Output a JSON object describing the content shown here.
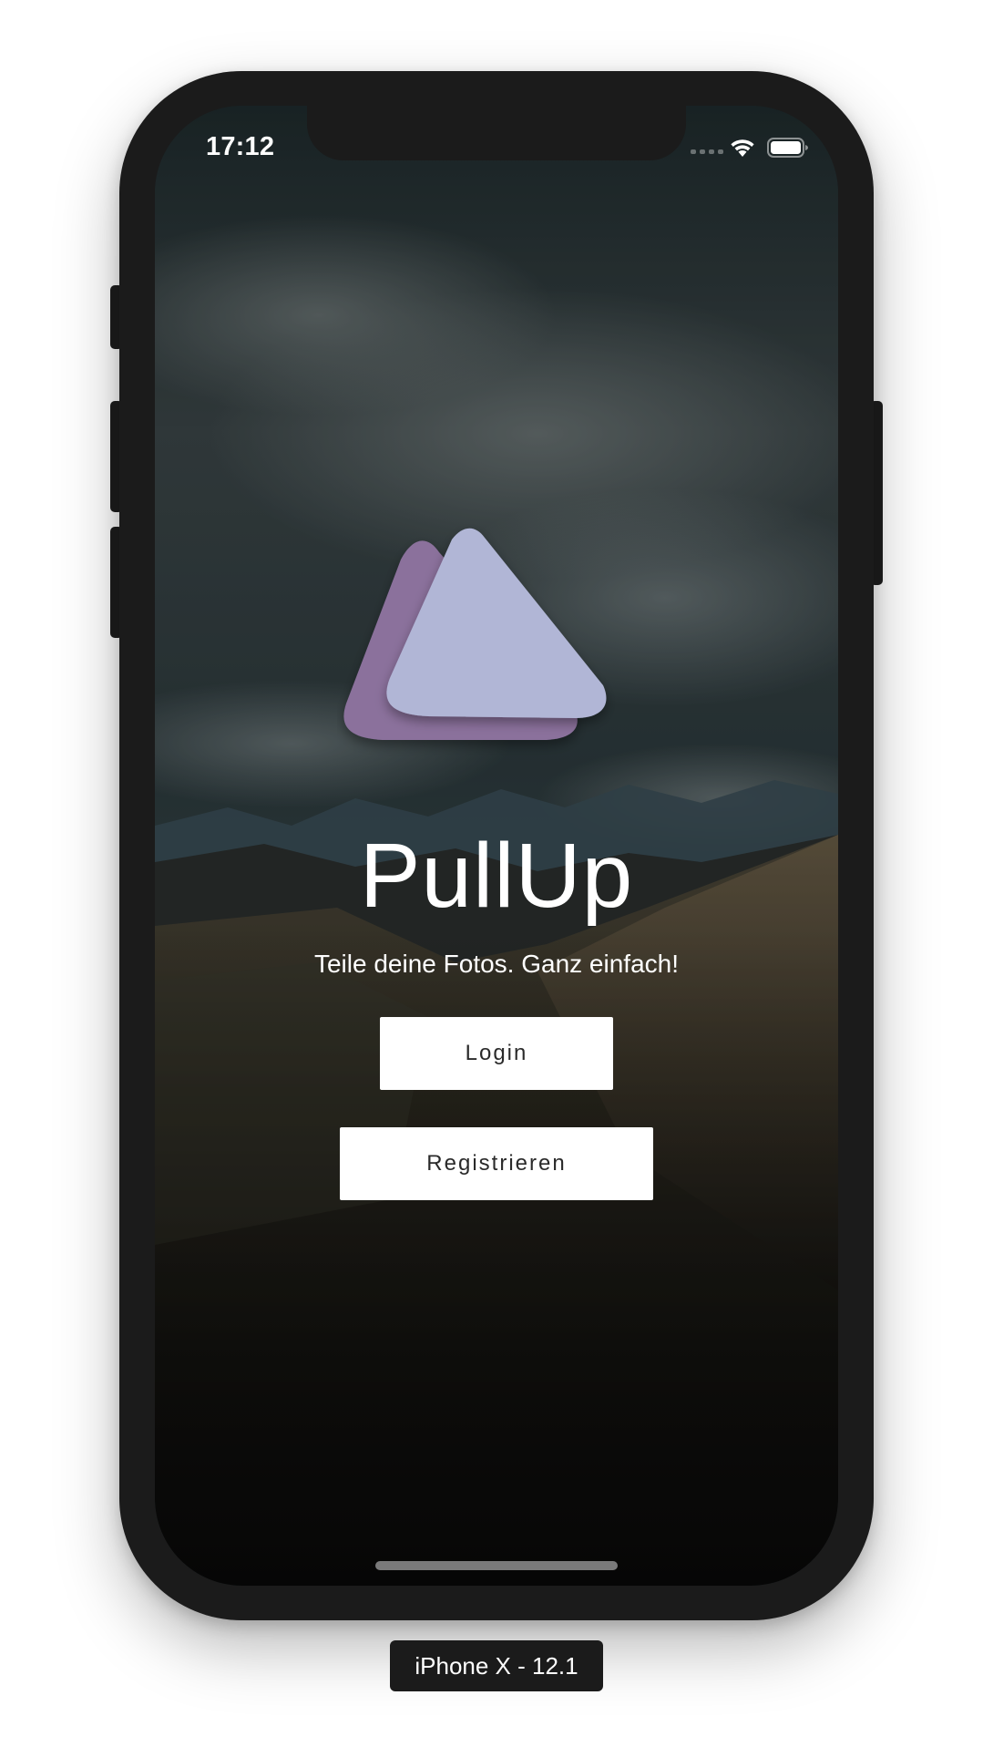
{
  "status_bar": {
    "time": "17:12",
    "icons": [
      "cellular-signal-icon",
      "wifi-icon",
      "battery-icon"
    ]
  },
  "app": {
    "logo": "pullup-logo",
    "title": "PullUp",
    "tagline": "Teile deine Fotos. Ganz einfach!",
    "buttons": {
      "login": "Login",
      "register": "Registrieren"
    }
  },
  "device": {
    "label": "iPhone X - 12.1"
  },
  "colors": {
    "logo_front": "#b1b6d6",
    "logo_back": "#8b719c",
    "button_bg": "#ffffff",
    "button_text": "#2a2a2a",
    "device_frame": "#1b1b1b"
  }
}
